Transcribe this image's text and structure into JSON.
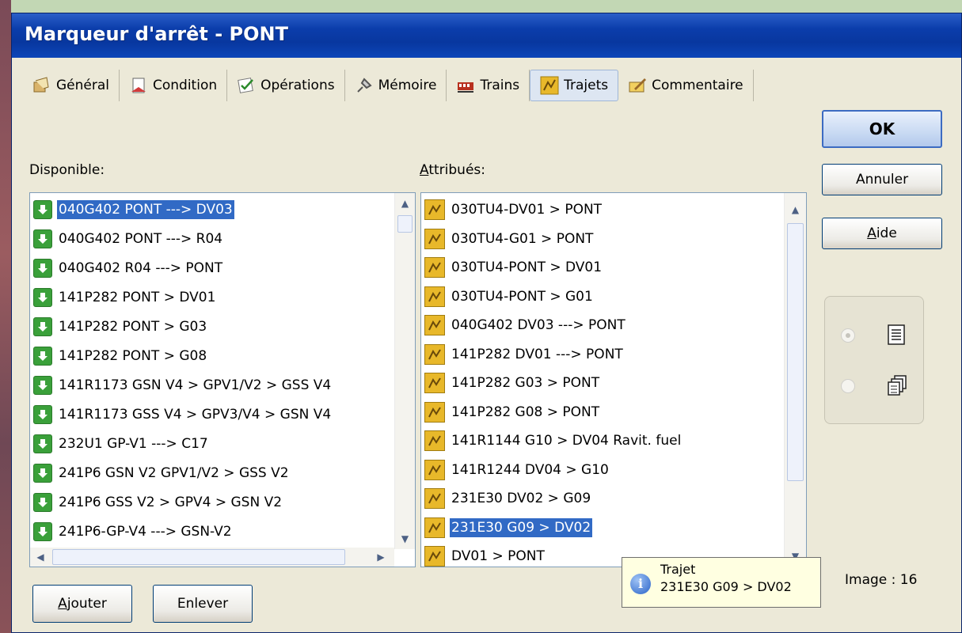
{
  "window": {
    "title": "Marqueur d'arrêt - PONT"
  },
  "tabs": [
    {
      "label": "Général",
      "icon": "general-icon"
    },
    {
      "label": "Condition",
      "icon": "condition-icon"
    },
    {
      "label": "Opérations",
      "icon": "operations-icon"
    },
    {
      "label": "Mémoire",
      "icon": "memory-icon"
    },
    {
      "label": "Trains",
      "icon": "trains-icon"
    },
    {
      "label": "Trajets",
      "icon": "routes-icon",
      "active": true
    },
    {
      "label": "Commentaire",
      "icon": "comment-icon"
    }
  ],
  "available": {
    "label": "Disponible:",
    "items": [
      "040G402 PONT ---> DV03",
      "040G402 PONT ---> R04",
      "040G402 R04 ---> PONT",
      "141P282 PONT > DV01",
      "141P282 PONT > G03",
      "141P282 PONT > G08",
      "141R1173 GSN V4 > GPV1/V2 > GSS V4",
      "141R1173 GSS V4 > GPV3/V4 > GSN V4",
      "232U1 GP-V1 ---> C17",
      "241P6 GSN V2 GPV1/V2 > GSS V2",
      "241P6 GSS V2 > GPV4 > GSN V2",
      "241P6-GP-V4 ---> GSN-V2"
    ],
    "selected_index": 0
  },
  "assigned": {
    "label_prefix": "",
    "label_underlined": "A",
    "label_rest": "ttribués:",
    "items": [
      "030TU4-DV01 > PONT",
      "030TU4-G01 > PONT",
      "030TU4-PONT > DV01",
      "030TU4-PONT > G01",
      "040G402 DV03 ---> PONT",
      "141P282 DV01 ---> PONT",
      "141P282 G03 > PONT",
      "141P282 G08 > PONT",
      "141R1144 G10 > DV04 Ravit. fuel",
      "141R1244 DV04 > G10",
      "231E30 DV02 > G09",
      "231E30 G09 > DV02",
      "DV01 > PONT"
    ],
    "selected_index": 11
  },
  "buttons": {
    "ok": "OK",
    "cancel": "Annuler",
    "help_u": "A",
    "help_rest": "ide",
    "add_u": "A",
    "add_rest": "jouter",
    "remove": "Enlever"
  },
  "view_mode": {
    "options": [
      "list-view-icon",
      "details-view-icon"
    ],
    "selected": 0
  },
  "tooltip": {
    "title": "Trajet",
    "text": "231E30 G09 > DV02"
  },
  "image_label": "Image : 16"
}
